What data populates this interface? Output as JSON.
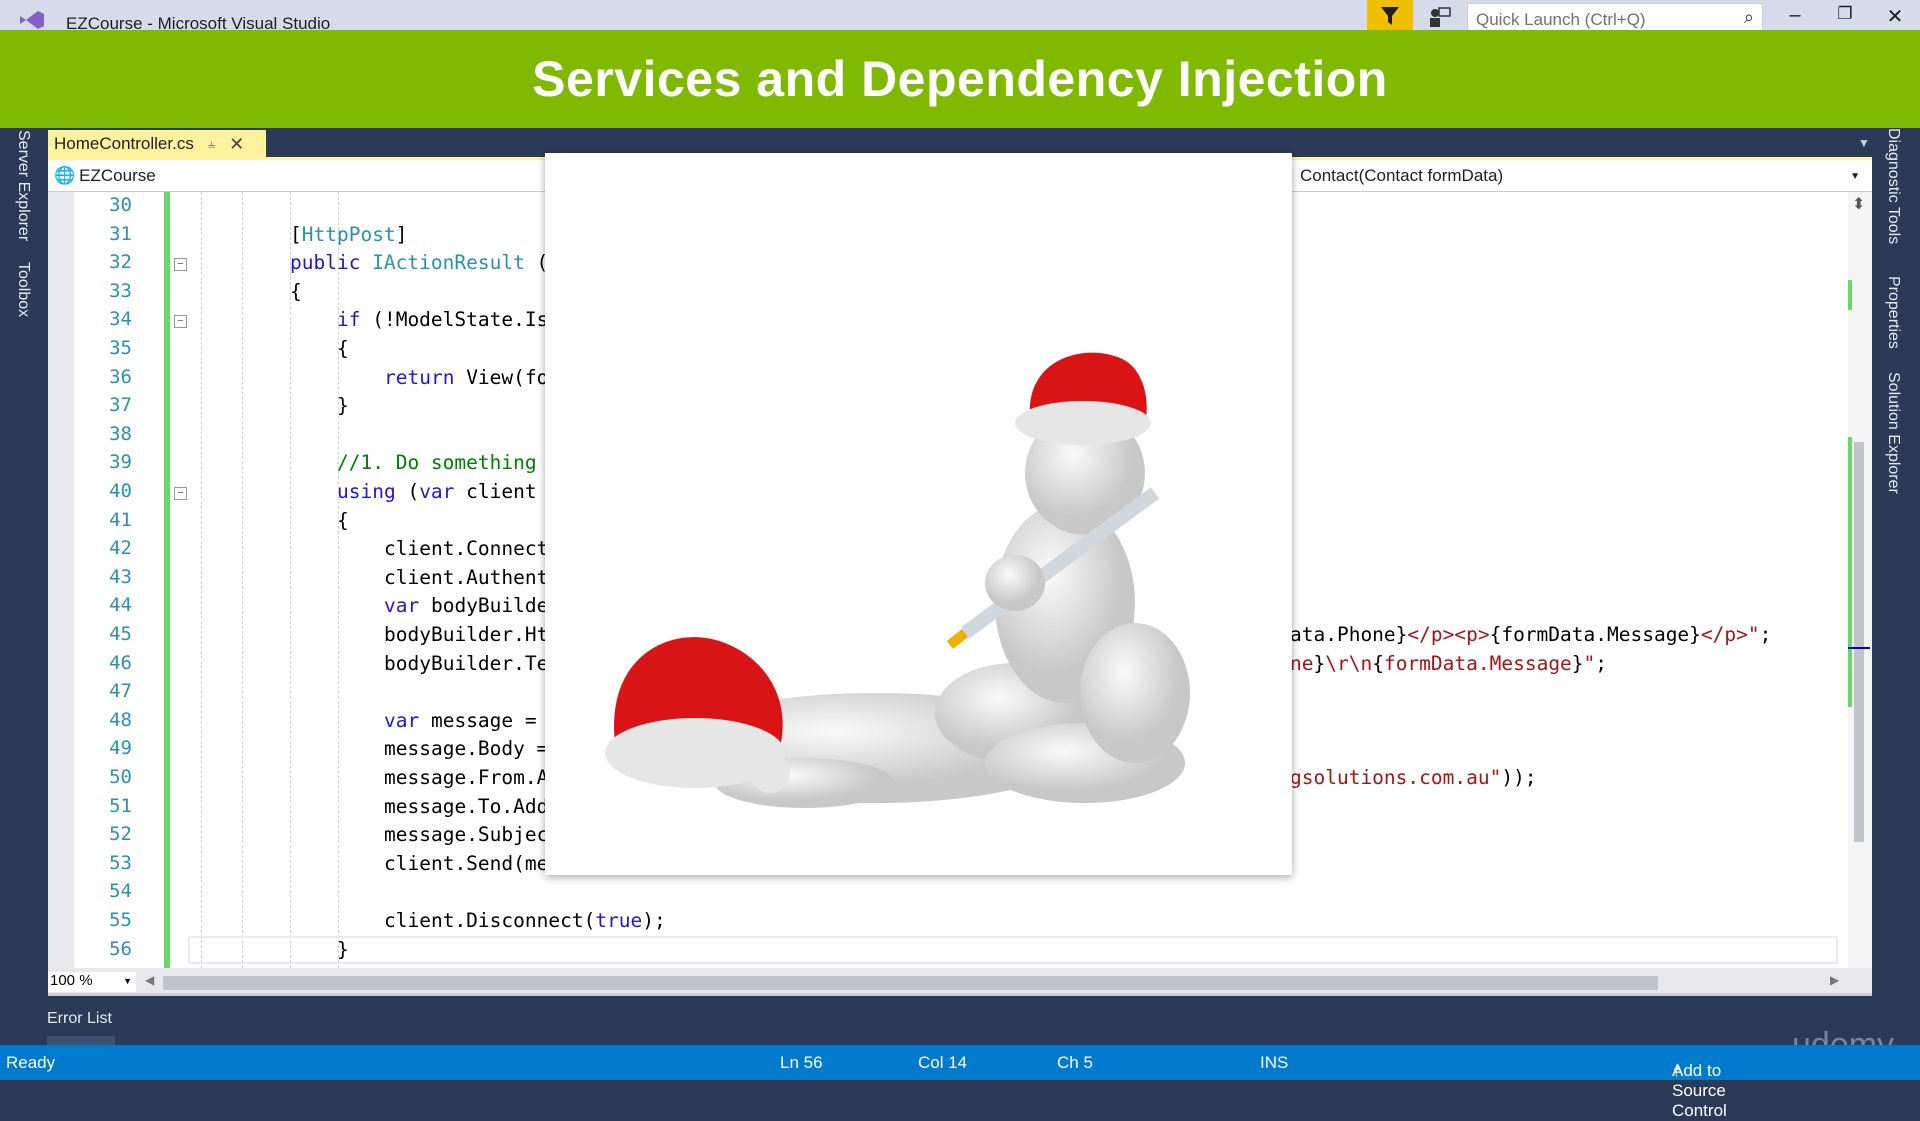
{
  "window": {
    "title": "EZCourse - Microsoft Visual Studio",
    "quick_launch_placeholder": "Quick Launch (Ctrl+Q)"
  },
  "banner": {
    "title": "Services and Dependency Injection"
  },
  "left_tools": [
    "Server Explorer",
    "Toolbox"
  ],
  "right_tools": [
    "Diagnostic Tools",
    "Properties",
    "Solution Explorer"
  ],
  "tab": {
    "label": "HomeController.cs"
  },
  "navbar": {
    "project": "EZCourse",
    "member": "Contact(Contact formData)"
  },
  "code": {
    "lines": [
      {
        "n": "30",
        "indent": 0,
        "tokens": []
      },
      {
        "n": "31",
        "indent": 2,
        "tokens": [
          [
            "[",
            "br"
          ],
          [
            "HttpPost",
            "ty"
          ],
          [
            "]",
            "br"
          ]
        ]
      },
      {
        "n": "32",
        "indent": 2,
        "fold": true,
        "tokens": [
          [
            "public ",
            "kw"
          ],
          [
            "IActionResult",
            "ty"
          ],
          [
            " (",
            "tx"
          ]
        ]
      },
      {
        "n": "33",
        "indent": 2,
        "tokens": [
          [
            "{",
            "br"
          ]
        ]
      },
      {
        "n": "34",
        "indent": 3,
        "fold": true,
        "tokens": [
          [
            "if",
            "kw"
          ],
          [
            " (!ModelState.Is",
            "tx"
          ]
        ]
      },
      {
        "n": "35",
        "indent": 3,
        "tokens": [
          [
            "{",
            "br"
          ]
        ]
      },
      {
        "n": "36",
        "indent": 4,
        "tokens": [
          [
            "return",
            "kw"
          ],
          [
            " View(fo",
            "tx"
          ]
        ]
      },
      {
        "n": "37",
        "indent": 3,
        "tokens": [
          [
            "}",
            "br"
          ]
        ]
      },
      {
        "n": "38",
        "indent": 0,
        "tokens": []
      },
      {
        "n": "39",
        "indent": 3,
        "tokens": [
          [
            "//1. Do something",
            "cm"
          ]
        ]
      },
      {
        "n": "40",
        "indent": 3,
        "fold": true,
        "tokens": [
          [
            "using",
            "kw"
          ],
          [
            " (",
            "tx"
          ],
          [
            "var",
            "kw"
          ],
          [
            " client",
            "tx"
          ]
        ]
      },
      {
        "n": "41",
        "indent": 3,
        "tokens": [
          [
            "{",
            "br"
          ]
        ]
      },
      {
        "n": "42",
        "indent": 4,
        "tokens": [
          [
            "client.Connect",
            "tx"
          ]
        ]
      },
      {
        "n": "43",
        "indent": 4,
        "tokens": [
          [
            "client.Authent",
            "tx"
          ]
        ]
      },
      {
        "n": "44",
        "indent": 4,
        "tokens": [
          [
            "var",
            "kw"
          ],
          [
            " bodyBuilde",
            "tx"
          ]
        ]
      },
      {
        "n": "45",
        "indent": 4,
        "tokens": [
          [
            "bodyBuilder.Ht",
            "tx"
          ]
        ],
        "right": [
          [
            "ata.Phone}",
            "tx"
          ],
          [
            "</p><p>",
            "st"
          ],
          [
            "{formData.Message}",
            "tx"
          ],
          [
            "</p>\"",
            "st"
          ],
          [
            ";",
            "tx"
          ]
        ]
      },
      {
        "n": "46",
        "indent": 4,
        "tokens": [
          [
            "bodyBuilder.Te",
            "tx"
          ]
        ],
        "right": [
          [
            "ne",
            "st"
          ],
          [
            "}",
            "tx"
          ],
          [
            "\\r\\n",
            "st"
          ],
          [
            "{",
            "tx"
          ],
          [
            "formData.Message",
            "st"
          ],
          [
            "}",
            "tx"
          ],
          [
            "\"",
            "st"
          ],
          [
            ";",
            "tx"
          ]
        ]
      },
      {
        "n": "47",
        "indent": 0,
        "tokens": []
      },
      {
        "n": "48",
        "indent": 4,
        "tokens": [
          [
            "var",
            "kw"
          ],
          [
            " message =",
            "tx"
          ]
        ]
      },
      {
        "n": "49",
        "indent": 4,
        "tokens": [
          [
            "message.Body =",
            "tx"
          ]
        ]
      },
      {
        "n": "50",
        "indent": 4,
        "tokens": [
          [
            "message.From.A",
            "tx"
          ]
        ],
        "right": [
          [
            "gsolutions.com.au\"",
            "st"
          ],
          [
            "));",
            "tx"
          ]
        ]
      },
      {
        "n": "51",
        "indent": 4,
        "tokens": [
          [
            "message.To.Add",
            "tx"
          ]
        ]
      },
      {
        "n": "52",
        "indent": 4,
        "tokens": [
          [
            "message.Subjec",
            "tx"
          ]
        ]
      },
      {
        "n": "53",
        "indent": 4,
        "tokens": [
          [
            "client.Send(me",
            "tx"
          ]
        ]
      },
      {
        "n": "54",
        "indent": 0,
        "tokens": []
      },
      {
        "n": "55",
        "indent": 4,
        "tokens": [
          [
            "client.Disconnect(",
            "tx"
          ],
          [
            "true",
            "kw"
          ],
          [
            ");",
            "tx"
          ]
        ]
      },
      {
        "n": "56",
        "indent": 3,
        "tokens": [
          [
            "}",
            "br"
          ]
        ]
      }
    ]
  },
  "editor": {
    "zoom": "100 %"
  },
  "panels": {
    "error_list": "Error List"
  },
  "status": {
    "state": "Ready",
    "line": "Ln 56",
    "col": "Col 14",
    "ch": "Ch 5",
    "mode": "INS",
    "source_control": "Add to Source Control"
  },
  "watermark": "udemy",
  "colors": {
    "banner": "#7fba00",
    "status_bar": "#007acc",
    "tab_active": "#fff29d",
    "background": "#2b3a57"
  }
}
